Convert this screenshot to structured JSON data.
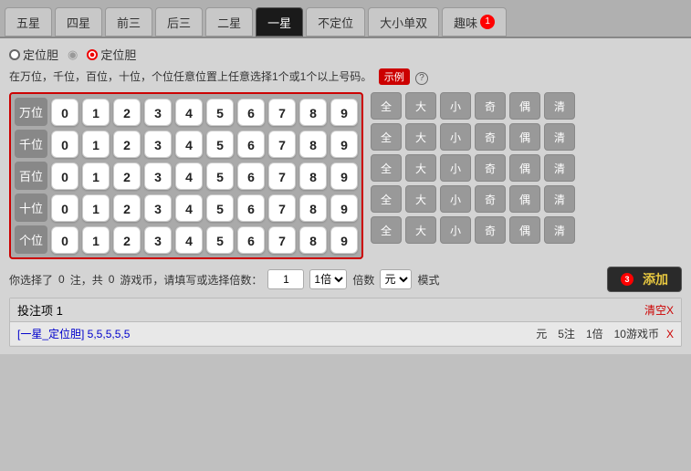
{
  "tabs": [
    {
      "label": "五星",
      "active": false
    },
    {
      "label": "四星",
      "active": false
    },
    {
      "label": "前三",
      "active": false
    },
    {
      "label": "后三",
      "active": false
    },
    {
      "label": "二星",
      "active": false
    },
    {
      "label": "一星",
      "active": true
    },
    {
      "label": "不定位",
      "active": false
    },
    {
      "label": "大小单双",
      "active": false
    },
    {
      "label": "趣味",
      "active": false,
      "badge": "1"
    }
  ],
  "radio_options": [
    {
      "label": "定位胆",
      "selected": false
    },
    {
      "label": "定位胆",
      "selected": true
    }
  ],
  "desc": "在万位，千位，百位，十位，个位任意位置上任意选择1个或1个以上号码。",
  "example_btn": "示例",
  "help": "?",
  "row_labels": [
    "万位",
    "千位",
    "百位",
    "十位",
    "个位"
  ],
  "digits": [
    "0",
    "1",
    "2",
    "3",
    "4",
    "5",
    "6",
    "7",
    "8",
    "9"
  ],
  "quick_labels": [
    "全",
    "大",
    "小",
    "奇",
    "偶",
    "清"
  ],
  "bottom": {
    "text1": "你选择了",
    "count": "0",
    "text2": "注，共",
    "coins": "0",
    "text3": "游戏币，请填写或选择倍数：",
    "input_value": "1",
    "select1_options": [
      "1倍"
    ],
    "select1_value": "1倍",
    "text4": "倍数",
    "select2_options": [
      "元"
    ],
    "select2_value": "元",
    "text5": "模式",
    "add_icon": "⊕",
    "add_label": "添加",
    "add_badge": "3"
  },
  "bet_list": {
    "title": "投注项  1",
    "clear_label": "清空X",
    "items": [
      {
        "label": "[一星_定位胆] 5,5,5,5,5",
        "currency": "元",
        "notes": "5注",
        "multiplier": "1倍",
        "coins": "10游戏币",
        "close": "X"
      }
    ]
  }
}
